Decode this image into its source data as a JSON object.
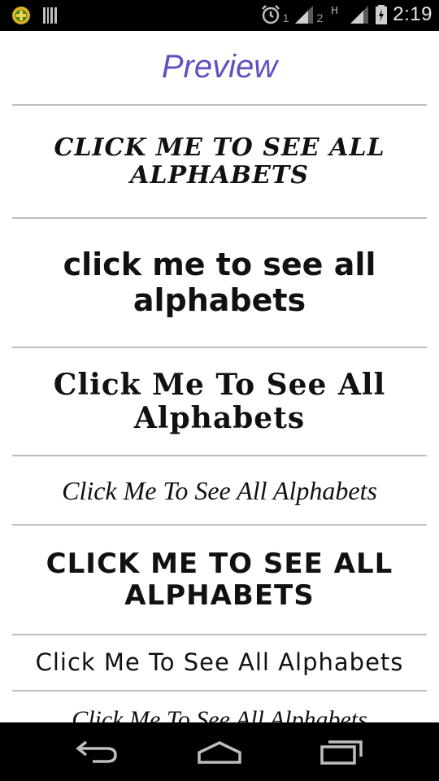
{
  "status_bar": {
    "time": "2:19",
    "sim1": "1",
    "sim2": "2"
  },
  "header": {
    "title": "Preview"
  },
  "font_list": [
    {
      "text": "CLICK ME TO SEE ALL ALPHABETS"
    },
    {
      "text": "click me to see all alphabets"
    },
    {
      "text": "Click Me To See All Alphabets"
    },
    {
      "text": "Click Me To See All Alphabets"
    },
    {
      "text": "CLICK ME TO SEE ALL ALPHABETS"
    },
    {
      "text": "Click Me To See All Alphabets"
    },
    {
      "text": "Click Me To See All Alphabets"
    }
  ],
  "nav": {
    "back": "back-icon",
    "home": "home-icon",
    "recents": "recents-icon"
  },
  "colors": {
    "title": "#5f52c0",
    "divider": "#bdbdbd",
    "bars": "#000000"
  }
}
